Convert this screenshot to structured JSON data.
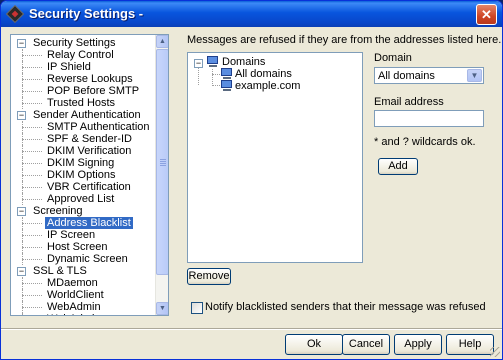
{
  "window": {
    "title": "Security Settings -",
    "close_glyph": "✕"
  },
  "nav": {
    "rows": [
      {
        "type": "parent",
        "label": "Security Settings"
      },
      {
        "type": "child",
        "label": "Relay Control"
      },
      {
        "type": "child",
        "label": "IP Shield"
      },
      {
        "type": "child",
        "label": "Reverse Lookups"
      },
      {
        "type": "child",
        "label": "POP Before SMTP"
      },
      {
        "type": "child",
        "label": "Trusted Hosts"
      },
      {
        "type": "parent",
        "label": "Sender Authentication"
      },
      {
        "type": "child",
        "label": "SMTP Authentication"
      },
      {
        "type": "child",
        "label": "SPF & Sender-ID"
      },
      {
        "type": "child",
        "label": "DKIM Verification"
      },
      {
        "type": "child",
        "label": "DKIM Signing"
      },
      {
        "type": "child",
        "label": "DKIM Options"
      },
      {
        "type": "child",
        "label": "VBR Certification"
      },
      {
        "type": "child",
        "label": "Approved List"
      },
      {
        "type": "parent",
        "label": "Screening"
      },
      {
        "type": "child",
        "label": "Address Blacklist",
        "selected": true
      },
      {
        "type": "child",
        "label": "IP Screen"
      },
      {
        "type": "child",
        "label": "Host Screen"
      },
      {
        "type": "child",
        "label": "Dynamic Screen"
      },
      {
        "type": "parent",
        "label": "SSL & TLS"
      },
      {
        "type": "child",
        "label": "MDaemon"
      },
      {
        "type": "child",
        "label": "WorldClient"
      },
      {
        "type": "child",
        "label": "WebAdmin"
      },
      {
        "type": "child",
        "label": "WebAdmin"
      }
    ],
    "expander_glyph": "−"
  },
  "main": {
    "info": "Messages are refused if they are from the addresses listed here.",
    "tree": {
      "root": "Domains",
      "children": [
        "All domains",
        "example.com"
      ]
    },
    "domain_label": "Domain",
    "domain_value": "All domains",
    "email_label": "Email address",
    "email_value": "",
    "wildcard_note": "* and ? wildcards ok.",
    "add_label": "Add",
    "remove_label": "Remove",
    "notify_label": "Notify blacklisted senders that their message was refused",
    "notify_checked": false
  },
  "footer": {
    "ok_label": "Ok",
    "cancel_label": "Cancel",
    "apply_label": "Apply",
    "help_label": "Help"
  },
  "icons": {
    "tree_nodes": "computer-icon",
    "scroll_up": "scroll-up-icon",
    "scroll_down": "scroll-down-icon",
    "select_arrow": "chevron-down-icon"
  },
  "colors": {
    "titlebar": "#0855dd",
    "selection": "#316ac5",
    "window_bg": "#ece9d8"
  }
}
